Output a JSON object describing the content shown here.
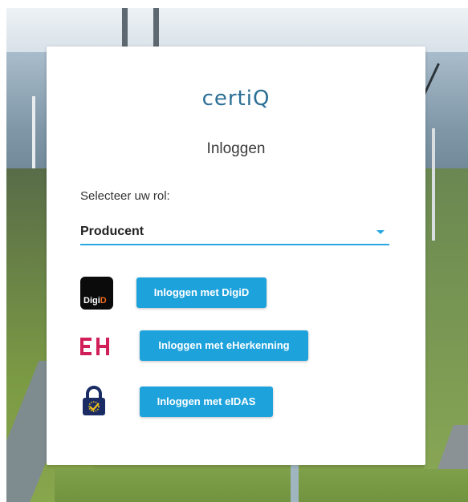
{
  "logo": {
    "text": "certiQ"
  },
  "login": {
    "title": "Inloggen",
    "role_label": "Selecteer uw rol:",
    "role_value": "Producent",
    "buttons": {
      "digid": "Inloggen met DigiD",
      "eherkenning": "Inloggen met eHerkenning",
      "eidas": "Inloggen met eIDAS"
    }
  },
  "icons": {
    "digid": {
      "name": "digid-icon",
      "text_digi": "Digi",
      "text_d": "D"
    },
    "eherkenning": {
      "name": "eherkenning-icon",
      "text": "EH"
    },
    "eidas": {
      "name": "eidas-lock-icon"
    }
  },
  "colors": {
    "accent": "#1ea2dc",
    "logo": "#2c6f96",
    "eh": "#d11f5a",
    "digid_bg": "#0b0b0b",
    "digid_accent": "#f26b1d"
  }
}
